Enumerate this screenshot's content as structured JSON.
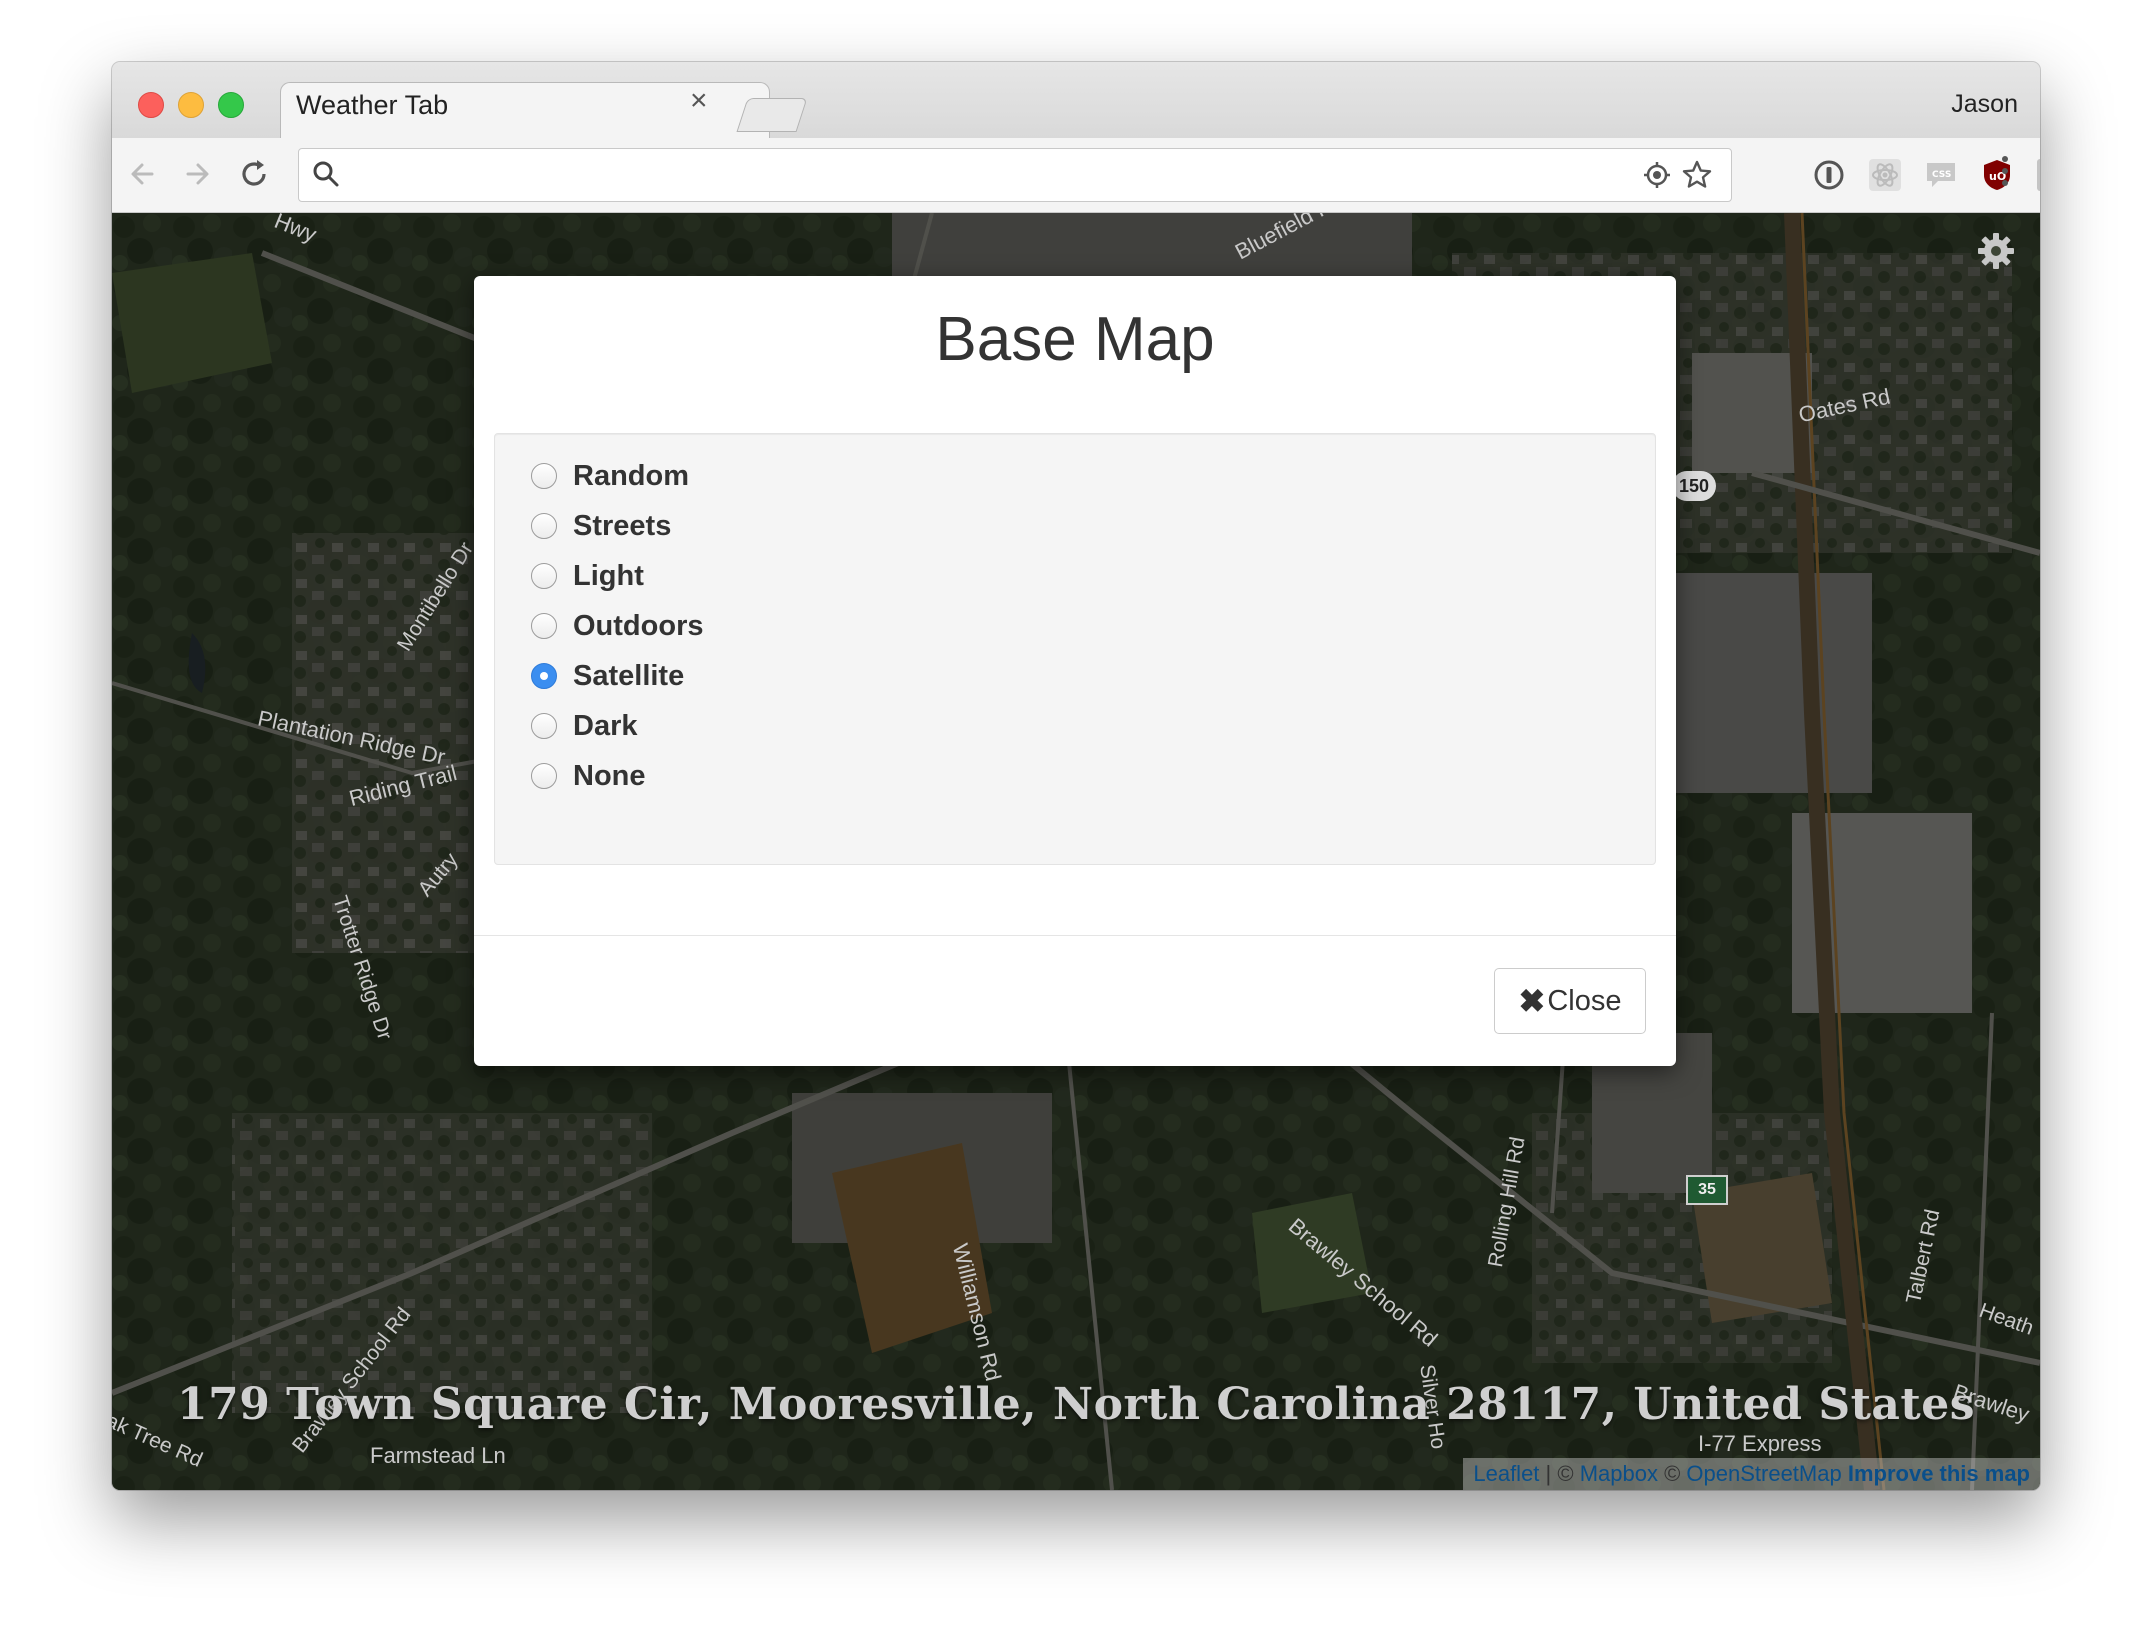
{
  "browser": {
    "tab_title": "Weather Tab",
    "tab_close": "×",
    "profile_name": "Jason",
    "omnibox_value": "",
    "extensions": [
      "1password-icon",
      "react-devtools-icon",
      "css-viewer-icon",
      "ublock-icon",
      "w-extension-icon"
    ]
  },
  "map": {
    "address": "179 Town Square Cir, Mooresville, North Carolina 28117, United States",
    "attribution": {
      "leaflet": "Leaflet",
      "sep1": " | © ",
      "mapbox": "Mapbox",
      "sep2": " © ",
      "osm": "OpenStreetMap",
      "improve": "Improve this map"
    },
    "labels": {
      "oates_rd": "Oates Rd",
      "hwy": "Hwy",
      "bluefield": "Bluefield Rd",
      "montibello": "Montibello Dr",
      "plantation": "Plantation Ridge Dr",
      "riding_trail": "Riding Trail",
      "trotter": "Trotter Ridge Dr",
      "autry": "Autry",
      "route150": "150",
      "route35": "35",
      "brawley": "Brawley School Rd",
      "rolling_hill": "Rolling Hill Rd",
      "williamson": "Williamson Rd",
      "talbert": "Talbert Rd",
      "heath": "Heath",
      "brawley_right": "Brawley",
      "silver": "Silver Ho",
      "i77": "I-77 Express",
      "farmstead": "Farmstead Ln",
      "oak_tree": "ak Tree Rd",
      "brawley_left": "Brawley School Rd"
    }
  },
  "modal": {
    "title": "Base Map",
    "options": [
      {
        "label": "Random",
        "checked": false
      },
      {
        "label": "Streets",
        "checked": false
      },
      {
        "label": "Light",
        "checked": false
      },
      {
        "label": "Outdoors",
        "checked": false
      },
      {
        "label": "Satellite",
        "checked": true
      },
      {
        "label": "Dark",
        "checked": false
      },
      {
        "label": "None",
        "checked": false
      }
    ],
    "close_label": "Close",
    "close_icon": "✖"
  },
  "colors": {
    "accent_radio": "#3b8ef0",
    "link": "#0a4f8a"
  }
}
